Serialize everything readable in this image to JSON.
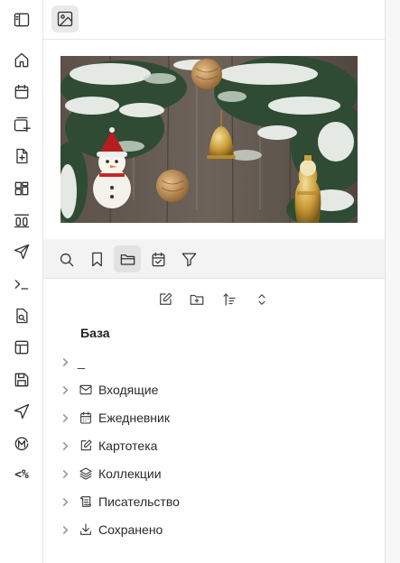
{
  "ribbon": {
    "items": [
      {
        "name": "sidebar-toggle",
        "icon": "sidebar-left-icon"
      },
      {
        "name": "home",
        "icon": "home-icon"
      },
      {
        "name": "daily-note",
        "icon": "calendar-icon"
      },
      {
        "name": "new-card",
        "icon": "card-plus-icon"
      },
      {
        "name": "new-note",
        "icon": "file-plus-icon"
      },
      {
        "name": "dashboard",
        "icon": "layout-dashboard-icon"
      },
      {
        "name": "templates",
        "icon": "double-zero-icon"
      },
      {
        "name": "send",
        "icon": "send-icon"
      },
      {
        "name": "terminal",
        "icon": "terminal-icon"
      },
      {
        "name": "file-search",
        "icon": "file-search-icon"
      },
      {
        "name": "layout",
        "icon": "layout-icon"
      },
      {
        "name": "save",
        "icon": "save-icon"
      },
      {
        "name": "navigation",
        "icon": "navigation-icon"
      },
      {
        "name": "medium",
        "icon": "m-circle-icon"
      }
    ],
    "code_label": "<%"
  },
  "header": {
    "active_tab_icon": "image-icon"
  },
  "banner": {
    "subject": "christmas-decorations-image"
  },
  "nav": {
    "buttons": [
      {
        "name": "search",
        "icon": "search-icon",
        "active": false
      },
      {
        "name": "bookmarks",
        "icon": "bookmark-icon",
        "active": false
      },
      {
        "name": "files",
        "icon": "folder-icon",
        "active": true
      },
      {
        "name": "tasks",
        "icon": "calendar-check-icon",
        "active": false
      },
      {
        "name": "filter",
        "icon": "filter-icon",
        "active": false
      }
    ]
  },
  "file_actions": [
    "new-note-icon",
    "new-folder-icon",
    "sort-icon",
    "collapse-icon"
  ],
  "vault": {
    "name": "База"
  },
  "tree": {
    "items": [
      {
        "label": "_",
        "icon": ""
      },
      {
        "label": "Входящие",
        "icon": "mail-icon"
      },
      {
        "label": "Ежедневник",
        "icon": "calendar-days-icon"
      },
      {
        "label": "Картотека",
        "icon": "edit-icon"
      },
      {
        "label": "Коллекции",
        "icon": "layers-icon"
      },
      {
        "label": "Писательство",
        "icon": "scroll-icon"
      },
      {
        "label": "Сохранено",
        "icon": "download-icon"
      }
    ]
  },
  "colors": {
    "accent_bg": "#e2e2e2",
    "nav_bg": "#f3f3f3",
    "icon": "#333333"
  }
}
